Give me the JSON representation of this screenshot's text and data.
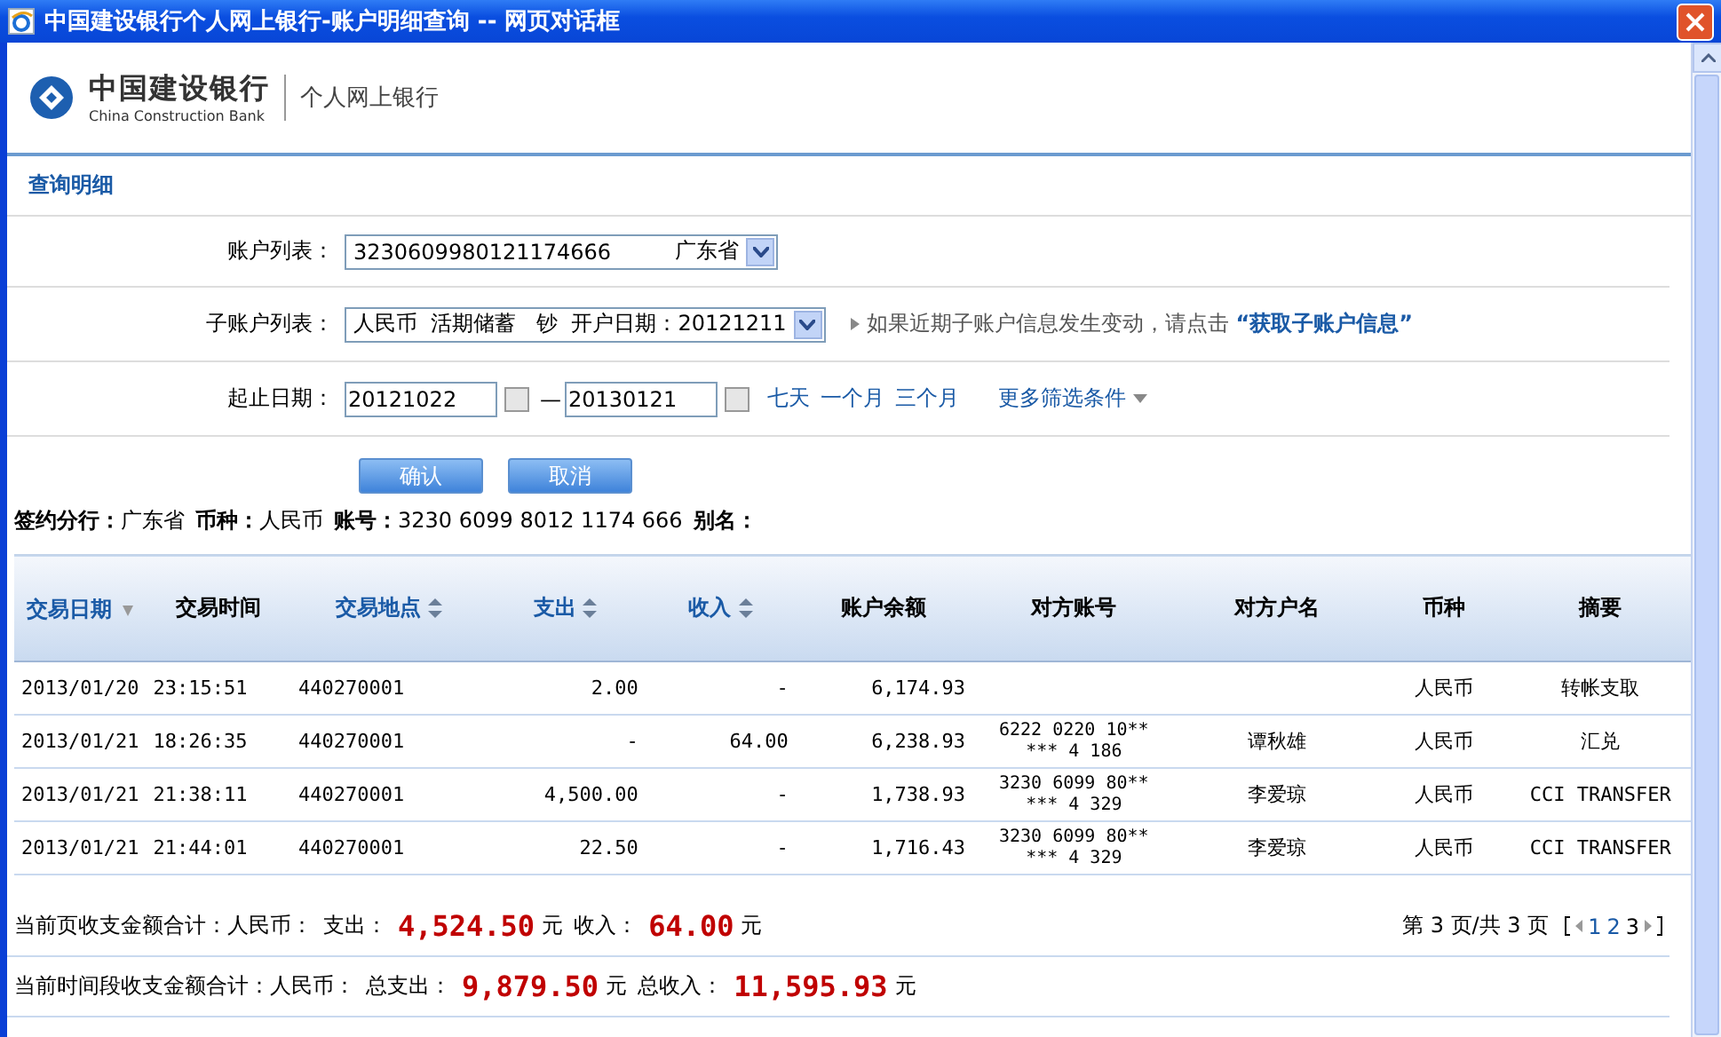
{
  "window": {
    "title": "中国建设银行个人网上银行-账户明细查询 -- 网页对话框"
  },
  "header": {
    "bank_name": "中国建设银行",
    "bank_name_en": "China Construction Bank",
    "service": "个人网上银行"
  },
  "section_title": "查询明细",
  "form": {
    "account": {
      "label": "账户列表：",
      "number": "3230609980121174666",
      "region": "广东省"
    },
    "sub_account": {
      "label": "子账户列表：",
      "value": "人民币  活期储蓄   钞  开户日期：20121211",
      "hint": "如果近期子账户信息发生变动，请点击",
      "hint_link": "“获取子账户信息”"
    },
    "dates": {
      "label": "起止日期：",
      "start": "20121022",
      "separator": "—",
      "end": "20130121",
      "quick": [
        "七天",
        "一个月",
        "三个月"
      ],
      "more": "更多筛选条件"
    },
    "buttons": [
      "确认",
      "取消"
    ]
  },
  "info": [
    {
      "label": "签约分行：",
      "value": "广东省"
    },
    {
      "label": "币种：",
      "value": "人民币"
    },
    {
      "label": "账号：",
      "value": "3230 6099 8012 1174 666"
    },
    {
      "label": "别名："
    }
  ],
  "table": {
    "columns": [
      {
        "label": "交易日期",
        "kind": "sorted"
      },
      {
        "label": "交易时间",
        "kind": "plain"
      },
      {
        "label": "交易地点",
        "kind": "sortable"
      },
      {
        "label": "支出",
        "kind": "sortable"
      },
      {
        "label": "收入",
        "kind": "sortable"
      },
      {
        "label": "账户余额",
        "kind": "plain"
      },
      {
        "label": "对方账号",
        "kind": "plain"
      },
      {
        "label": "对方户名",
        "kind": "plain"
      },
      {
        "label": "币种",
        "kind": "plain"
      },
      {
        "label": "摘要",
        "kind": "plain"
      }
    ],
    "rows": [
      [
        "2013/01/20",
        "23:15:51",
        "440270001",
        "2.00",
        "-",
        "6,174.93",
        "",
        "",
        "人民币",
        "转帐支取"
      ],
      [
        "2013/01/21",
        "18:26:35",
        "440270001",
        "-",
        "64.00",
        "6,238.93",
        "6222 0220 10** *** 4 186",
        "谭秋雄",
        "人民币",
        "汇兑"
      ],
      [
        "2013/01/21",
        "21:38:11",
        "440270001",
        "4,500.00",
        "-",
        "1,738.93",
        "3230 6099 80** *** 4 329",
        "李爱琼",
        "人民币",
        "CCI TRANSFER"
      ],
      [
        "2013/01/21",
        "21:44:01",
        "440270001",
        "22.50",
        "-",
        "1,716.43",
        "3230 6099 80** *** 4 329",
        "李爱琼",
        "人民币",
        "CCI TRANSFER"
      ]
    ]
  },
  "page_total": {
    "label": "当前页收支金额合计：人民币：",
    "out_label": "支出：",
    "out": "4,524.50",
    "in_label": "收入：",
    "in": "64.00",
    "unit_out": "元",
    "unit_in": "元"
  },
  "pagination": {
    "text": "第 3 页/共 3 页",
    "pages": [
      {
        "label": "1",
        "selected": false
      },
      {
        "label": "2",
        "selected": false
      },
      {
        "label": "3",
        "selected": true
      }
    ]
  },
  "period_total": {
    "label": "当前时间段收支金额合计：人民币：",
    "out_label": "总支出：",
    "out": "9,879.50",
    "in_label": "总收入：",
    "in": "11,595.93",
    "unit_out": "元",
    "unit_in": "元"
  }
}
